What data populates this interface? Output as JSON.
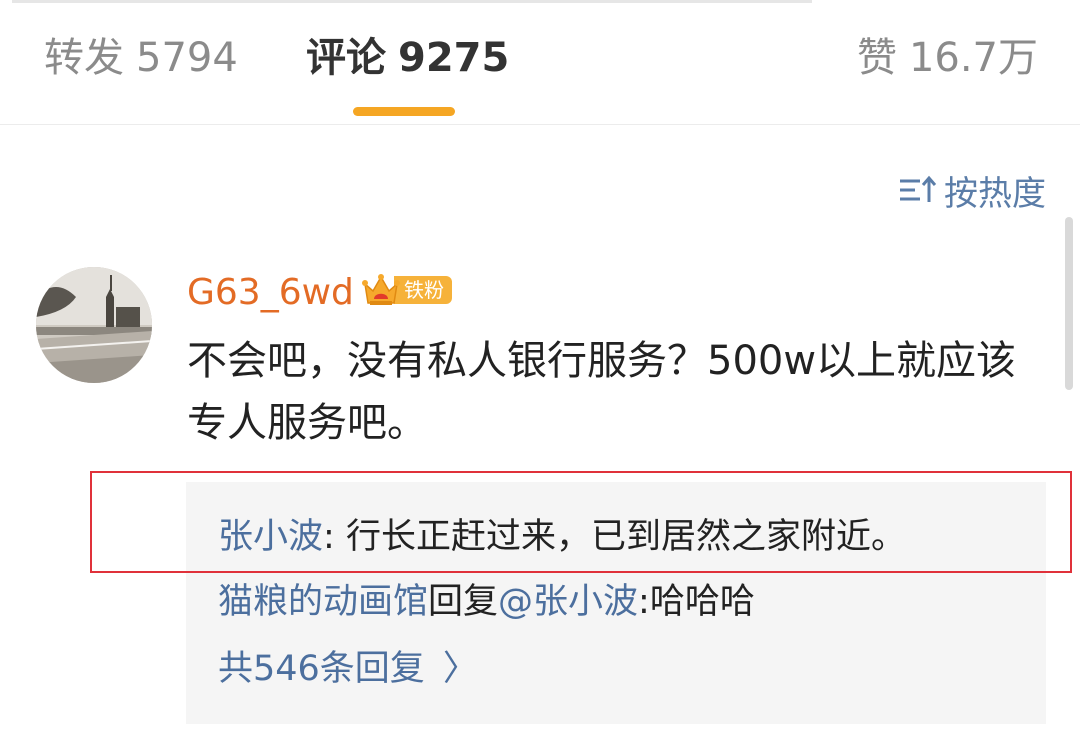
{
  "tabs": [
    {
      "label": "转发",
      "count": "5794"
    },
    {
      "label": "评论",
      "count": "9275"
    },
    {
      "label": "赞",
      "count": "16.7万"
    }
  ],
  "sort": {
    "label": "按热度",
    "icon": "sort-icon"
  },
  "comment": {
    "username": "G63_6wd",
    "badge": "铁粉",
    "badge_icon": "crown-icon",
    "avatar": "avatar-image",
    "text": "不会吧，没有私人银行服务？500w以上就应该专人服务吧。"
  },
  "replies": {
    "first": {
      "author": "张小波",
      "separator": ": ",
      "text": "行长正赶过来，已到居然之家附近。"
    },
    "second": {
      "author": "猫粮的动画馆",
      "action": "回复",
      "mention": "@张小波",
      "separator": ":",
      "text": "哈哈哈"
    },
    "more": "共546条回复",
    "more_arrow": "〉"
  },
  "colors": {
    "accent_orange": "#f5a623",
    "username_orange": "#e36b25",
    "link_blue": "#4c6f9e",
    "highlight_red": "#e0313a"
  }
}
